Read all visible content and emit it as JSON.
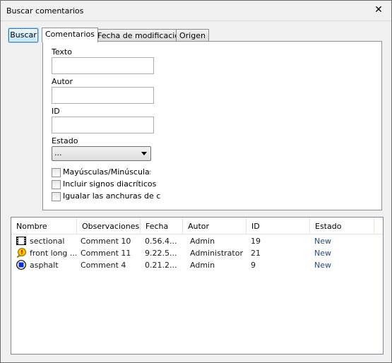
{
  "window": {
    "title": "Buscar comentarios",
    "close_label": "✕"
  },
  "search_button": "Buscar",
  "tabs": [
    {
      "label": "Comentarios",
      "active": true
    },
    {
      "label": "Fecha de modificación",
      "active": false
    },
    {
      "label": "Origen",
      "active": false
    }
  ],
  "form": {
    "texto_label": "Texto",
    "texto_value": "",
    "autor_label": "Autor",
    "autor_value": "",
    "id_label": "ID",
    "id_value": "",
    "estado_label": "Estado",
    "estado_value": "...",
    "checkboxes": [
      {
        "label": "Mayúsculas/Minúsculas",
        "checked": false
      },
      {
        "label": "Incluir signos diacríticos",
        "checked": false
      },
      {
        "label": "Igualar las anchuras de carác",
        "checked": false
      }
    ]
  },
  "results": {
    "columns": [
      "Nombre",
      "Observaciones",
      "Fecha",
      "Autor",
      "ID",
      "Estado"
    ],
    "rows": [
      {
        "icon": "film-strip-icon",
        "nombre": "sectional",
        "observaciones": "Comment 10",
        "fecha": "0.56.4...",
        "autor": "Admin",
        "id": "19",
        "estado": "New"
      },
      {
        "icon": "warning-balloon-icon",
        "nombre": "front long ...",
        "observaciones": "Comment 11",
        "fecha": "9.22.5...",
        "autor": "Administrator",
        "id": "21",
        "estado": "New"
      },
      {
        "icon": "blue-circle-icon",
        "nombre": "asphalt",
        "observaciones": "Comment 4",
        "fecha": "0.21.2...",
        "autor": "Admin",
        "id": "9",
        "estado": "New"
      }
    ]
  },
  "colors": {
    "accent": "#3c7fb1",
    "status_text": "#2b4d7a",
    "icon_blue": "#0b2fd6",
    "icon_yellow": "#f6c400"
  }
}
